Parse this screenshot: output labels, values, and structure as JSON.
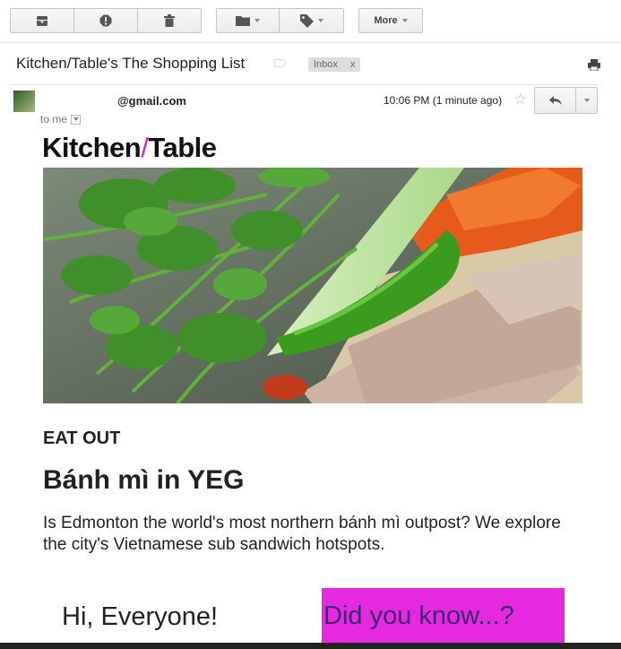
{
  "toolbar": {
    "archive_icon": "archive-icon",
    "spam_icon": "report-spam-icon",
    "delete_icon": "trash-icon",
    "move_icon": "folder-icon",
    "labels_icon": "tag-icon",
    "more_label": "More"
  },
  "email": {
    "subject": "Kitchen/Table's The Shopping List",
    "label_chip": "Inbox",
    "label_chip_remove": "x",
    "sender": "@gmail.com",
    "recipient": "to me",
    "timestamp": "10:06 PM (1 minute ago)"
  },
  "newsletter": {
    "brand_part1": "Kitchen",
    "brand_slash": "/",
    "brand_part2": "Table",
    "hero_image": "banh mi sandwich close-up with cilantro, jalapeño, carrot and pork",
    "section": "EAT OUT",
    "headline": "Bánh mì in YEG",
    "dek": "Is Edmonton the world's most northern bánh mì outpost? We explore the city's Vietnamese sub sandwich hotspots.",
    "greeting": "Hi, Everyone!",
    "did_you_know": "Did you know...?"
  },
  "colors": {
    "brand_accent": "#e020b0",
    "did_you_know_bg": "#e628e0",
    "did_you_know_text": "#3a2a70"
  }
}
